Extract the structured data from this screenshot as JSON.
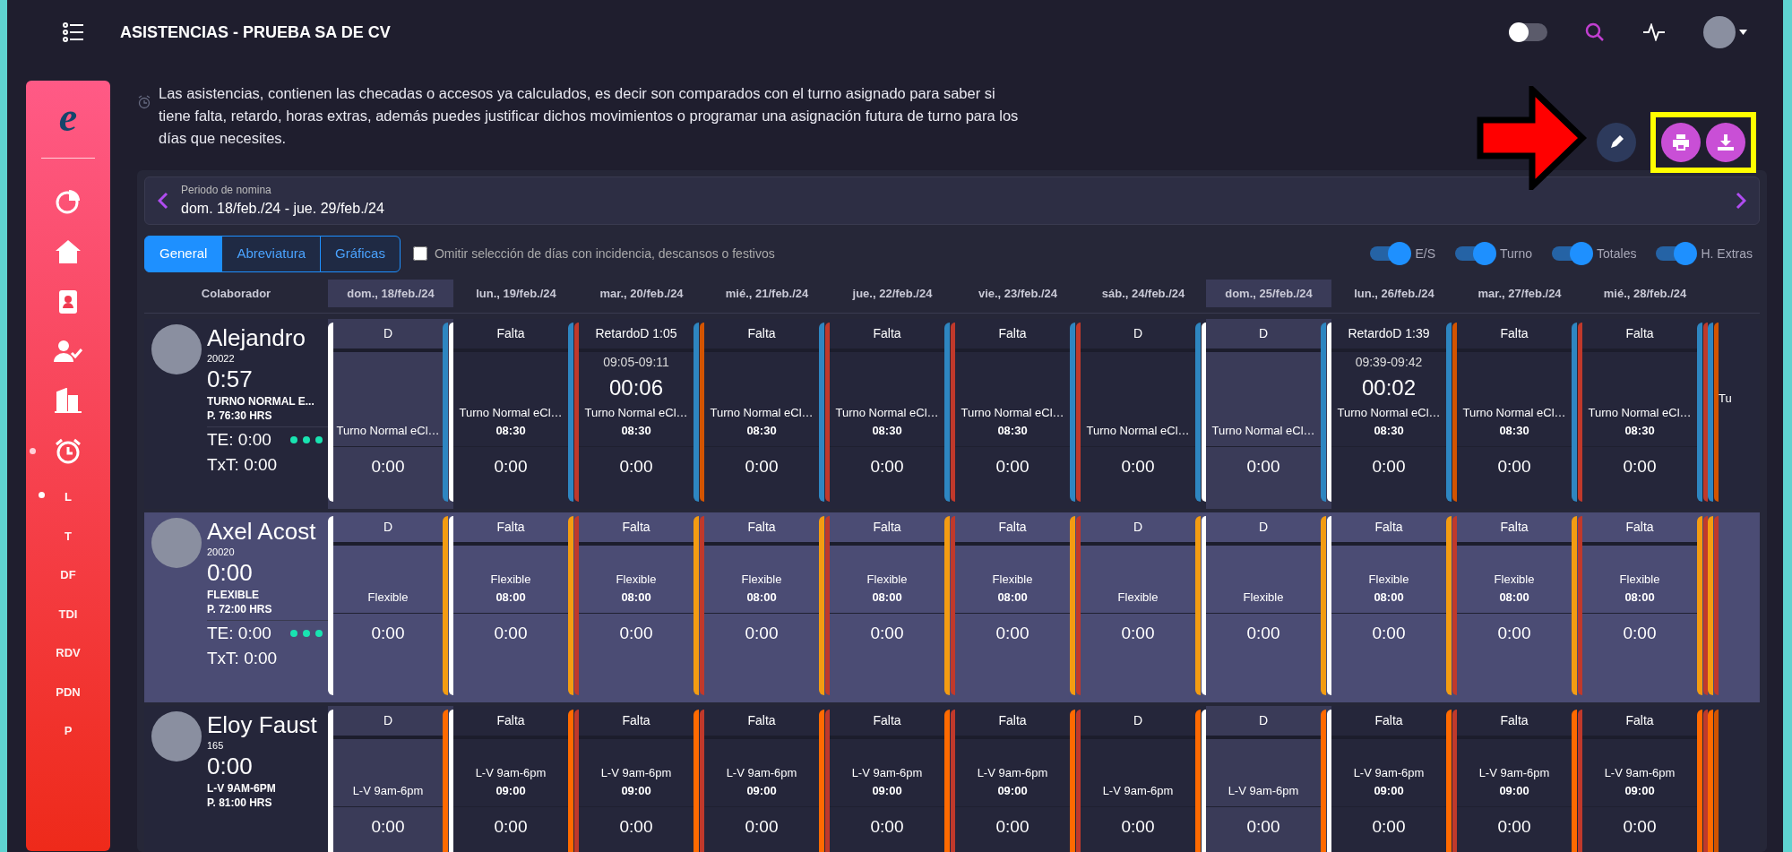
{
  "topbar": {
    "title": "ASISTENCIAS - PRUEBA SA DE CV",
    "theme_toggle": {
      "on": false
    }
  },
  "sidebar": {
    "logo": "e",
    "alarm_expanded": true,
    "sub_items": [
      {
        "label": "L",
        "selected": true
      },
      {
        "label": "T",
        "selected": false
      },
      {
        "label": "DF",
        "selected": false
      },
      {
        "label": "TDI",
        "selected": false
      },
      {
        "label": "RDV",
        "selected": false
      },
      {
        "label": "PDN",
        "selected": false
      },
      {
        "label": "P",
        "selected": false
      }
    ]
  },
  "description": "Las asistencias, contienen las checadas o accesos ya calculados, es decir son comparados con el turno asignado para saber si tiene falta, retardo, horas extras, además puedes justificar dichos movimientos o programar una asignación futura de turno para los días que necesites.",
  "period": {
    "label": "Periodo de nomina",
    "value": "dom. 18/feb./24 - jue. 29/feb./24"
  },
  "view_tabs": [
    {
      "label": "General",
      "selected": true
    },
    {
      "label": "Abreviatura",
      "selected": false
    },
    {
      "label": "Gráficas",
      "selected": false
    }
  ],
  "omit_checkbox": {
    "label": "Omitir selección de días con incidencia, descansos o festivos",
    "checked": false
  },
  "toggles": [
    {
      "label": "E/S",
      "on": true
    },
    {
      "label": "Turno",
      "on": true
    },
    {
      "label": "Totales",
      "on": true
    },
    {
      "label": "H. Extras",
      "on": true
    }
  ],
  "table": {
    "column_header": "Colaborador",
    "days": [
      {
        "label": "dom., 18/feb./24",
        "highlighted": true
      },
      {
        "label": "lun., 19/feb./24",
        "highlighted": false
      },
      {
        "label": "mar., 20/feb./24",
        "highlighted": false
      },
      {
        "label": "mié., 21/feb./24",
        "highlighted": false
      },
      {
        "label": "jue., 22/feb./24",
        "highlighted": false
      },
      {
        "label": "vie., 23/feb./24",
        "highlighted": false
      },
      {
        "label": "sáb., 24/feb./24",
        "highlighted": false
      },
      {
        "label": "dom., 25/feb./24",
        "highlighted": true
      },
      {
        "label": "lun., 26/feb./24",
        "highlighted": false
      },
      {
        "label": "mar., 27/feb./24",
        "highlighted": false
      },
      {
        "label": "mié., 28/feb./24",
        "highlighted": false
      }
    ],
    "rows": [
      {
        "name": "Alejandro",
        "id": "20022",
        "balance": "0:57",
        "shift": "TURNO NORMAL E...",
        "hours": "P. 76:30 HRS",
        "te": "TE: 0:00",
        "txt": "TxT: 0:00",
        "selected": false,
        "color": "#2e86c1",
        "cells": [
          {
            "status": "D",
            "color": "#ffffff",
            "shift": "Turno Normal eCl…",
            "total": "0:00"
          },
          {
            "status": "Falta",
            "color": "#c0392b",
            "shift": "Turno Normal eCl…",
            "hours": "08:30",
            "total": "0:00"
          },
          {
            "status": "RetardoD 1:05",
            "color": "#d35400",
            "range": "09:05-09:11",
            "duration": "00:06",
            "shift": "Turno Normal eCl…",
            "hours": "08:30",
            "total": "0:00"
          },
          {
            "status": "Falta",
            "color": "#c0392b",
            "shift": "Turno Normal eCl…",
            "hours": "08:30",
            "total": "0:00"
          },
          {
            "status": "Falta",
            "color": "#c0392b",
            "shift": "Turno Normal eCl…",
            "hours": "08:30",
            "total": "0:00"
          },
          {
            "status": "Falta",
            "color": "#c0392b",
            "shift": "Turno Normal eCl…",
            "hours": "08:30",
            "total": "0:00"
          },
          {
            "status": "D",
            "color": "#ffffff",
            "shift": "Turno Normal eCl…",
            "total": "0:00"
          },
          {
            "status": "D",
            "color": "#ffffff",
            "shift": "Turno Normal eCl…",
            "total": "0:00"
          },
          {
            "status": "RetardoD 1:39",
            "color": "#d35400",
            "range": "09:39-09:42",
            "duration": "00:02",
            "shift": "Turno Normal eCl…",
            "hours": "08:30",
            "total": "0:00"
          },
          {
            "status": "Falta",
            "color": "#c0392b",
            "shift": "Turno Normal eCl…",
            "hours": "08:30",
            "total": "0:00"
          },
          {
            "status": "Falta",
            "color": "#c0392b",
            "shift": "Turno Normal eCl…",
            "hours": "08:30",
            "total": "0:00"
          },
          {
            "color": "#d35400",
            "shift": "Tu"
          }
        ]
      },
      {
        "name": "Axel Acost",
        "id": "20020",
        "balance": "0:00",
        "shift": "FLEXIBLE",
        "hours": "P. 72:00 HRS",
        "te": "TE: 0:00",
        "txt": "TxT: 0:00",
        "selected": true,
        "color": "#f39c12",
        "cells": [
          {
            "status": "D",
            "color": "#ffffff",
            "shift": "Flexible",
            "total": "0:00"
          },
          {
            "status": "Falta",
            "color": "#c0392b",
            "shift": "Flexible",
            "hours": "08:00",
            "total": "0:00"
          },
          {
            "status": "Falta",
            "color": "#c0392b",
            "shift": "Flexible",
            "hours": "08:00",
            "total": "0:00"
          },
          {
            "status": "Falta",
            "color": "#c0392b",
            "shift": "Flexible",
            "hours": "08:00",
            "total": "0:00"
          },
          {
            "status": "Falta",
            "color": "#c0392b",
            "shift": "Flexible",
            "hours": "08:00",
            "total": "0:00"
          },
          {
            "status": "Falta",
            "color": "#c0392b",
            "shift": "Flexible",
            "hours": "08:00",
            "total": "0:00"
          },
          {
            "status": "D",
            "color": "#ffffff",
            "shift": "Flexible",
            "total": "0:00"
          },
          {
            "status": "D",
            "color": "#ffffff",
            "shift": "Flexible",
            "total": "0:00"
          },
          {
            "status": "Falta",
            "color": "#c0392b",
            "shift": "Flexible",
            "hours": "08:00",
            "total": "0:00"
          },
          {
            "status": "Falta",
            "color": "#c0392b",
            "shift": "Flexible",
            "hours": "08:00",
            "total": "0:00"
          },
          {
            "status": "Falta",
            "color": "#c0392b",
            "shift": "Flexible",
            "hours": "08:00",
            "total": "0:00"
          },
          {
            "color": "#c0392b"
          }
        ]
      },
      {
        "name": "Eloy Faust",
        "id": "165",
        "balance": "0:00",
        "shift": "L-V 9AM-6PM",
        "hours": "P. 81:00 HRS",
        "selected": false,
        "color": "#ff6a00",
        "cells": [
          {
            "status": "D",
            "color": "#ffffff",
            "shift": "L-V 9am-6pm",
            "total": "0:00"
          },
          {
            "status": "Falta",
            "color": "#c0392b",
            "shift": "L-V 9am-6pm",
            "hours": "09:00",
            "total": "0:00"
          },
          {
            "status": "Falta",
            "color": "#c0392b",
            "shift": "L-V 9am-6pm",
            "hours": "09:00",
            "total": "0:00"
          },
          {
            "status": "Falta",
            "color": "#c0392b",
            "shift": "L-V 9am-6pm",
            "hours": "09:00",
            "total": "0:00"
          },
          {
            "status": "Falta",
            "color": "#c0392b",
            "shift": "L-V 9am-6pm",
            "hours": "09:00",
            "total": "0:00"
          },
          {
            "status": "Falta",
            "color": "#c0392b",
            "shift": "L-V 9am-6pm",
            "hours": "09:00",
            "total": "0:00"
          },
          {
            "status": "D",
            "color": "#ffffff",
            "shift": "L-V 9am-6pm",
            "total": "0:00"
          },
          {
            "status": "D",
            "color": "#ffffff",
            "shift": "L-V 9am-6pm",
            "total": "0:00"
          },
          {
            "status": "Falta",
            "color": "#c0392b",
            "shift": "L-V 9am-6pm",
            "hours": "09:00",
            "total": "0:00"
          },
          {
            "status": "Falta",
            "color": "#c0392b",
            "shift": "L-V 9am-6pm",
            "hours": "09:00",
            "total": "0:00"
          },
          {
            "status": "Falta",
            "color": "#c0392b",
            "shift": "L-V 9am-6pm",
            "hours": "09:00",
            "total": "0:00"
          },
          {
            "color": "#d35400"
          }
        ]
      }
    ]
  }
}
